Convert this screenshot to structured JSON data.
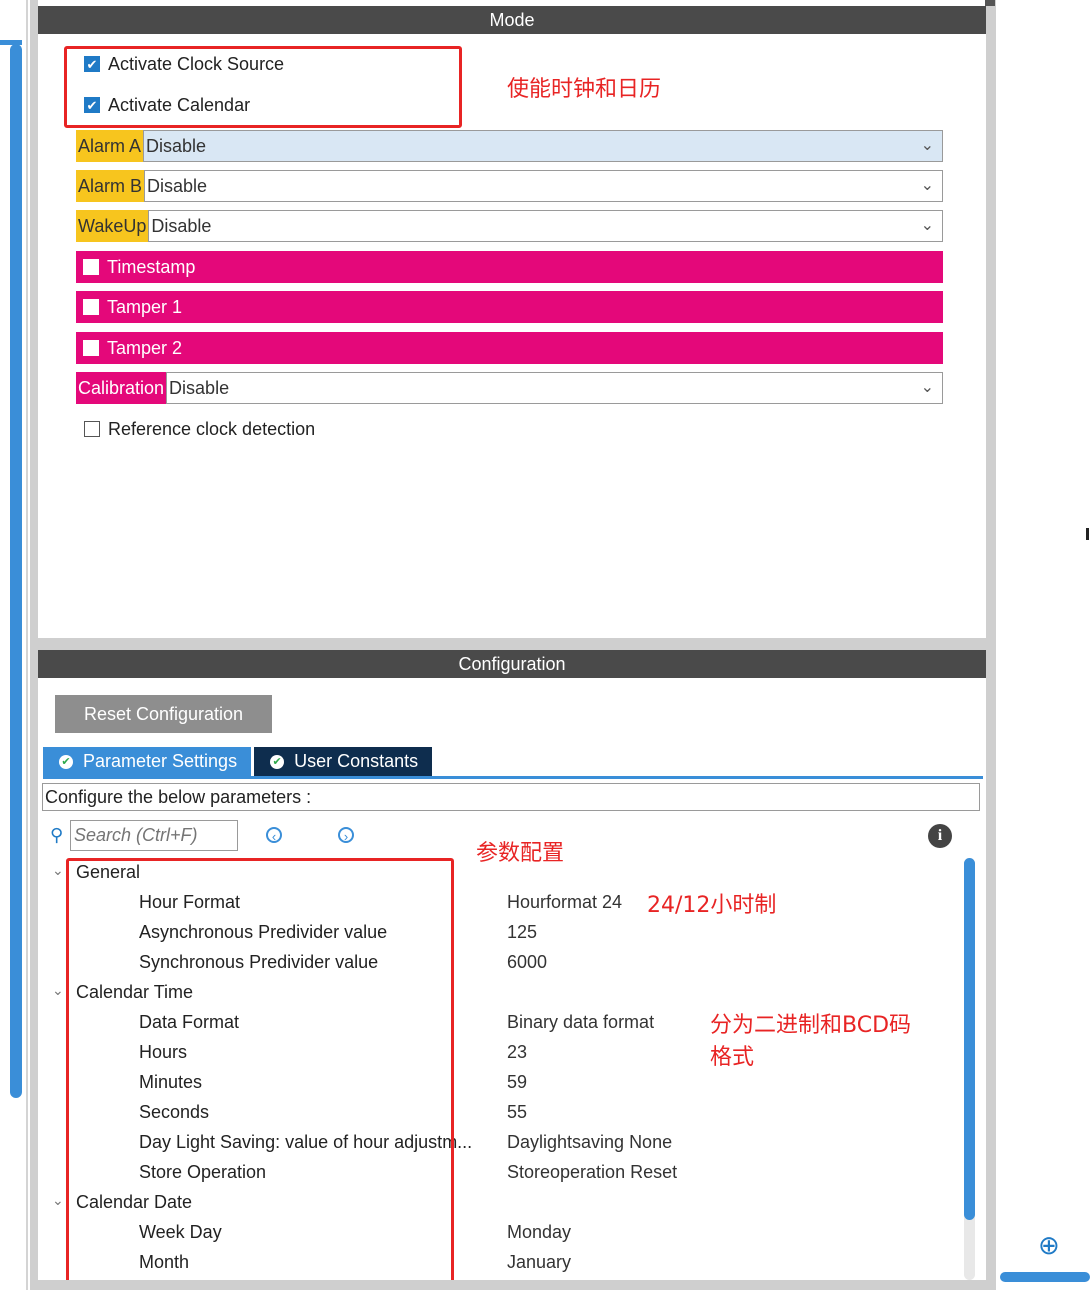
{
  "mode": {
    "header": "Mode",
    "activate_clock_source": {
      "label": "Activate Clock Source",
      "checked": true
    },
    "activate_calendar": {
      "label": "Activate Calendar",
      "checked": true
    },
    "alarm_a": {
      "label": "Alarm A",
      "value": "Disable"
    },
    "alarm_b": {
      "label": "Alarm B",
      "value": "Disable"
    },
    "wakeup": {
      "label": "WakeUp",
      "value": "Disable"
    },
    "timestamp": {
      "label": "Timestamp",
      "checked": false
    },
    "tamper1": {
      "label": "Tamper 1",
      "checked": false
    },
    "tamper2": {
      "label": "Tamper 2",
      "checked": false
    },
    "calibration": {
      "label": "Calibration",
      "value": "Disable"
    },
    "reference_clock": {
      "label": "Reference clock detection",
      "checked": false
    }
  },
  "annotations": {
    "enable_note": "使能时钟和日历",
    "params_note": "参数配置",
    "hour_note": "24/12小时制",
    "format_note_line1": "分为二进制和BCD码",
    "format_note_line2": "格式"
  },
  "configuration": {
    "header": "Configuration",
    "reset_button": "Reset Configuration",
    "tabs": [
      {
        "label": "Parameter Settings",
        "active": true
      },
      {
        "label": "User Constants",
        "active": false
      }
    ],
    "param_hint": "Configure the below parameters :",
    "search_placeholder": "Search (Ctrl+F)",
    "tree": {
      "general": "General",
      "hour_format": {
        "name": "Hour Format",
        "value": "Hourformat 24"
      },
      "async_prediv": {
        "name": "Asynchronous Predivider value",
        "value": "125"
      },
      "sync_prediv": {
        "name": "Synchronous Predivider value",
        "value": "6000"
      },
      "calendar_time": "Calendar Time",
      "data_format": {
        "name": "Data Format",
        "value": "Binary data format"
      },
      "hours": {
        "name": "Hours",
        "value": "23"
      },
      "minutes": {
        "name": "Minutes",
        "value": "59"
      },
      "seconds": {
        "name": "Seconds",
        "value": "55"
      },
      "daylight": {
        "name": "Day Light Saving: value of hour adjustm...",
        "value": "Daylightsaving None"
      },
      "store_op": {
        "name": "Store Operation",
        "value": "Storeoperation Reset"
      },
      "calendar_date": "Calendar Date",
      "week_day": {
        "name": "Week Day",
        "value": "Monday"
      },
      "month": {
        "name": "Month",
        "value": "January"
      }
    }
  },
  "colors": {
    "accent_blue": "#3a8ed8",
    "alarm_yellow": "#f7c51e",
    "magenta": "#e4087a",
    "annotation_red": "#e82424",
    "header_gray": "#4a4a4a"
  }
}
